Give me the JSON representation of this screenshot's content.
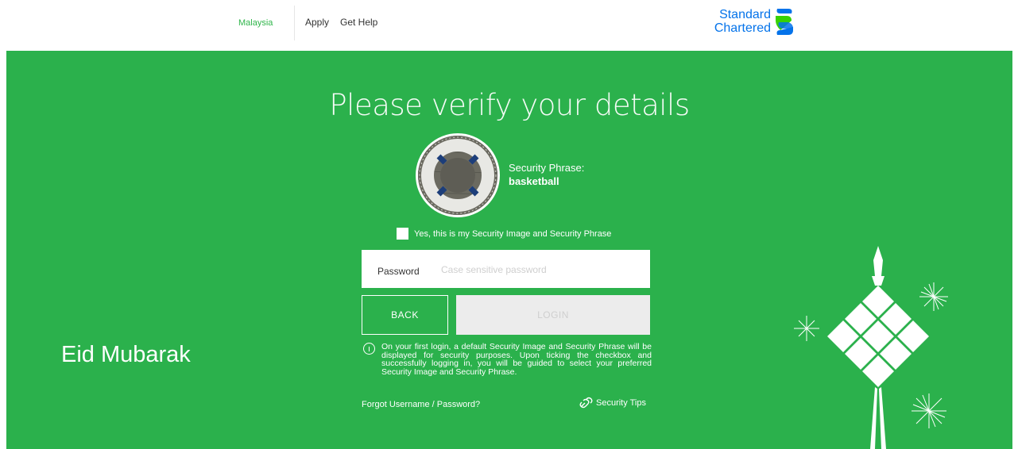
{
  "header": {
    "region": "Malaysia",
    "nav": [
      "Apply",
      "Get Help"
    ],
    "logo": {
      "line1": "Standard",
      "line2": "Chartered"
    }
  },
  "main": {
    "title": "Please verify your details",
    "security_phrase_label": "Security Phrase:",
    "security_phrase_value": "basketball",
    "confirm_checkbox_label": "Yes, this is my Security Image and Security Phrase",
    "password_label": "Password",
    "password_placeholder": "Case sensitive password",
    "back_label": "BACK",
    "login_label": "LOGIN",
    "info_text": "On your first login, a default Security Image and Security Phrase will be displayed for security purposes. Upon ticking the checkbox and successfully logging in, you will be guided to select your preferred Security Image and Security Phrase.",
    "forgot_link": "Forgot Username / Password?",
    "security_tips_link": "Security Tips"
  },
  "banner": {
    "greeting": "Eid Mubarak"
  },
  "colors": {
    "brand_green": "#2bb14c",
    "brand_blue": "#0473ea",
    "region_green": "#2fb54a"
  },
  "icons": [
    "standard-chartered-logo-icon",
    "security-image-lifebuoy",
    "info-icon",
    "security-tips-link-icon",
    "ketupat-decoration-icon",
    "firework-icon"
  ]
}
